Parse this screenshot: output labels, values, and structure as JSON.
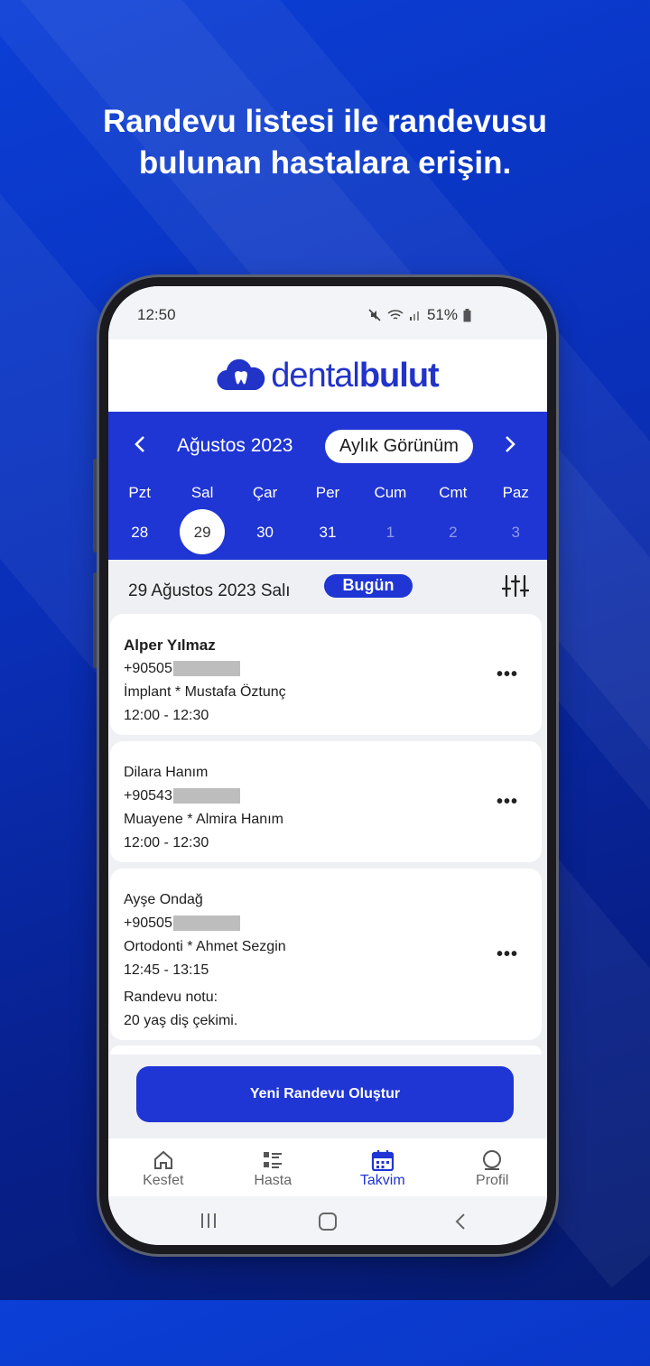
{
  "headline": {
    "line1": "Randevu listesi ile randevusu",
    "line2": "bulunan hastalara erişin."
  },
  "status_bar": {
    "time": "12:50",
    "battery": "51%"
  },
  "app": {
    "logo_light": "dental",
    "logo_bold": "bulut",
    "brand_color": "#1f35d4"
  },
  "calendar": {
    "month_label": "Ağustos 2023",
    "view_button": "Aylık Görünüm",
    "weekdays": [
      "Pzt",
      "Sal",
      "Çar",
      "Per",
      "Cum",
      "Cmt",
      "Paz"
    ],
    "days": [
      "28",
      "29",
      "30",
      "31",
      "1",
      "2",
      "3"
    ],
    "selected_day": "29"
  },
  "day_header": {
    "date": "29 Ağustos 2023 Salı",
    "today_badge": "Bugün"
  },
  "appointments": [
    {
      "patient": "Alper Yılmaz",
      "phone": "+90505",
      "treatment_line": "İmplant  *  Mustafa Öztunç",
      "time": "12:00 - 12:30"
    },
    {
      "patient": "Dilara Hanım",
      "phone": "+90543",
      "treatment_line": "Muayene  *  Almira Hanım",
      "time": "12:00 - 12:30"
    },
    {
      "patient": "Ayşe Ondağ",
      "phone": "+90505",
      "treatment_line": "Ortodonti  *  Ahmet Sezgin",
      "time": "12:45 - 13:15",
      "note_label": "Randevu notu:",
      "note": "20 yaş diş çekimi."
    }
  ],
  "more_label": "•••",
  "new_appointment_button": "Yeni Randevu Oluştur",
  "bottom_nav": [
    {
      "label": "Kesfet",
      "icon": "home-icon"
    },
    {
      "label": "Hasta",
      "icon": "list-icon"
    },
    {
      "label": "Takvim",
      "icon": "calendar-icon",
      "active": true
    },
    {
      "label": "Profil",
      "icon": "profile-icon"
    }
  ]
}
